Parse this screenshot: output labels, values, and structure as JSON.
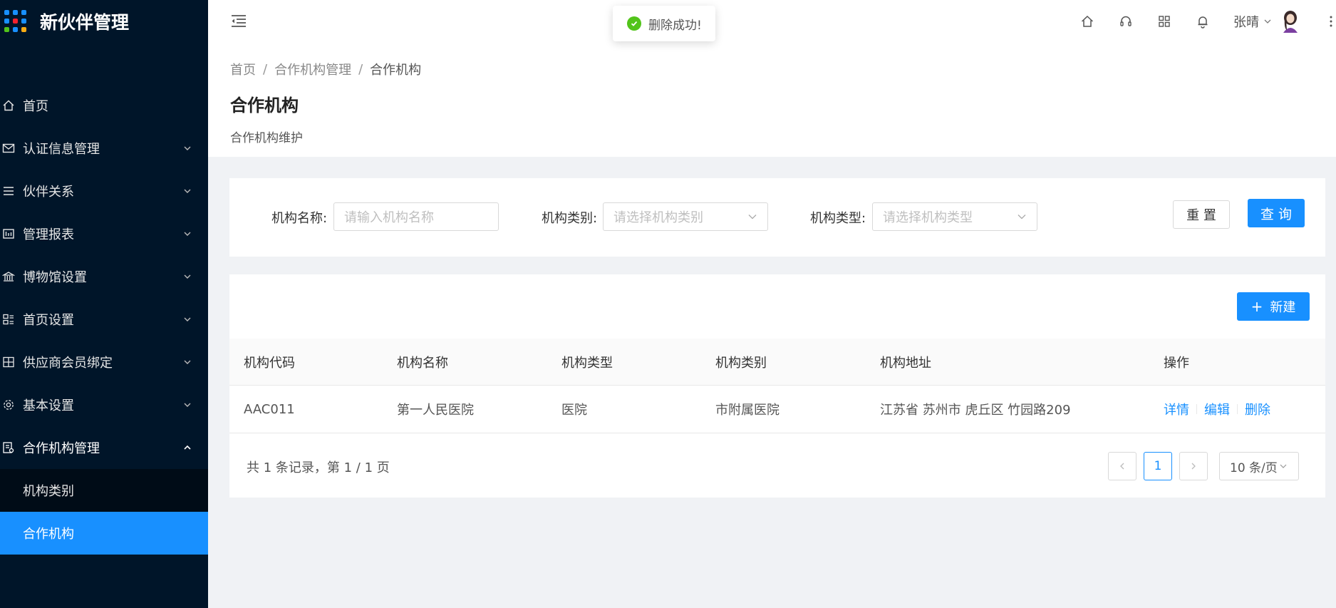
{
  "app": {
    "title": "新伙伴管理",
    "logo_colors": [
      "#1890ff",
      "#1890ff",
      "#1890ff",
      "#1890ff",
      "#f5222d",
      "#1890ff",
      "#52c41a",
      "#1890ff",
      "#faad14"
    ]
  },
  "sidebar": {
    "items": [
      {
        "label": "首页",
        "icon": "home-icon",
        "has_children": false
      },
      {
        "label": "认证信息管理",
        "icon": "mail-icon",
        "has_children": true
      },
      {
        "label": "伙伴关系",
        "icon": "list-icon",
        "has_children": true
      },
      {
        "label": "管理报表",
        "icon": "report-icon",
        "has_children": true
      },
      {
        "label": "博物馆设置",
        "icon": "bank-icon",
        "has_children": true
      },
      {
        "label": "首页设置",
        "icon": "layout-icon",
        "has_children": true
      },
      {
        "label": "供应商会员绑定",
        "icon": "grid-icon",
        "has_children": true
      },
      {
        "label": "基本设置",
        "icon": "gear-icon",
        "has_children": true
      },
      {
        "label": "合作机构管理",
        "icon": "org-icon",
        "has_children": true,
        "open": true
      }
    ],
    "submenu": [
      {
        "label": "机构类别",
        "active": false
      },
      {
        "label": "合作机构",
        "active": true
      }
    ]
  },
  "header": {
    "user_name": "张晴",
    "icons": [
      "home-icon",
      "headset-icon",
      "apps-icon",
      "bell-icon"
    ]
  },
  "toast": {
    "message": "删除成功!",
    "type": "success"
  },
  "page": {
    "breadcrumb": [
      "首页",
      "合作机构管理",
      "合作机构"
    ],
    "breadcrumb_sep": "/",
    "title": "合作机构",
    "description": "合作机构维护"
  },
  "search": {
    "name_label": "机构名称:",
    "name_placeholder": "请输入机构名称",
    "category_label": "机构类别:",
    "category_placeholder": "请选择机构类别",
    "type_label": "机构类型:",
    "type_placeholder": "请选择机构类型",
    "reset_label": "重 置",
    "query_label": "查 询"
  },
  "table": {
    "new_label": "新建",
    "columns": [
      "机构代码",
      "机构名称",
      "机构类型",
      "机构类别",
      "机构地址",
      "操作"
    ],
    "rows": [
      {
        "code": "AAC011",
        "name": "第一人民医院",
        "type": "医院",
        "category": "市附属医院",
        "address": "江苏省 苏州市 虎丘区 竹园路209"
      }
    ],
    "actions": [
      "详情",
      "编辑",
      "删除"
    ]
  },
  "pagination": {
    "summary": "共 1 条记录，第 1 / 1 页",
    "current_page": "1",
    "page_size": "10 条/页"
  },
  "colors": {
    "primary": "#1890ff",
    "sidebar_bg": "#001529",
    "success": "#52c41a"
  }
}
